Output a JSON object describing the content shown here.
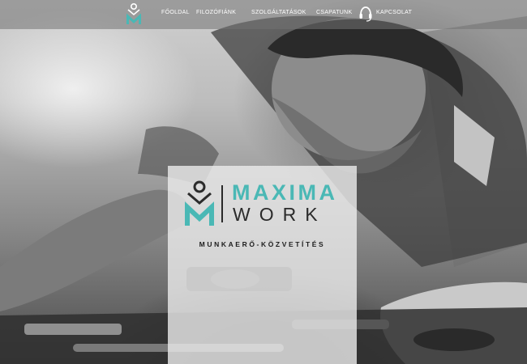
{
  "nav": {
    "items": [
      {
        "label": "FŐOLDAL"
      },
      {
        "label": "FILOZÓFIÁNK"
      },
      {
        "label": "SZOLGÁLTATÁSOK"
      },
      {
        "label": "CSAPATUNK"
      },
      {
        "label": "KAPCSOLAT"
      }
    ]
  },
  "brand": {
    "word_1": "MAXIMA",
    "word_2": "WORK",
    "tagline": "MUNKAERŐ-KÖZVETÍTÉS"
  },
  "colors": {
    "accent": "#4ab8b5",
    "dark": "#2b2b2b",
    "nav_text": "#ffffff"
  },
  "icons": {
    "nav_logo": "maxima-logo-icon",
    "contact": "headset-icon",
    "brand_logo": "maxima-logo-icon"
  }
}
